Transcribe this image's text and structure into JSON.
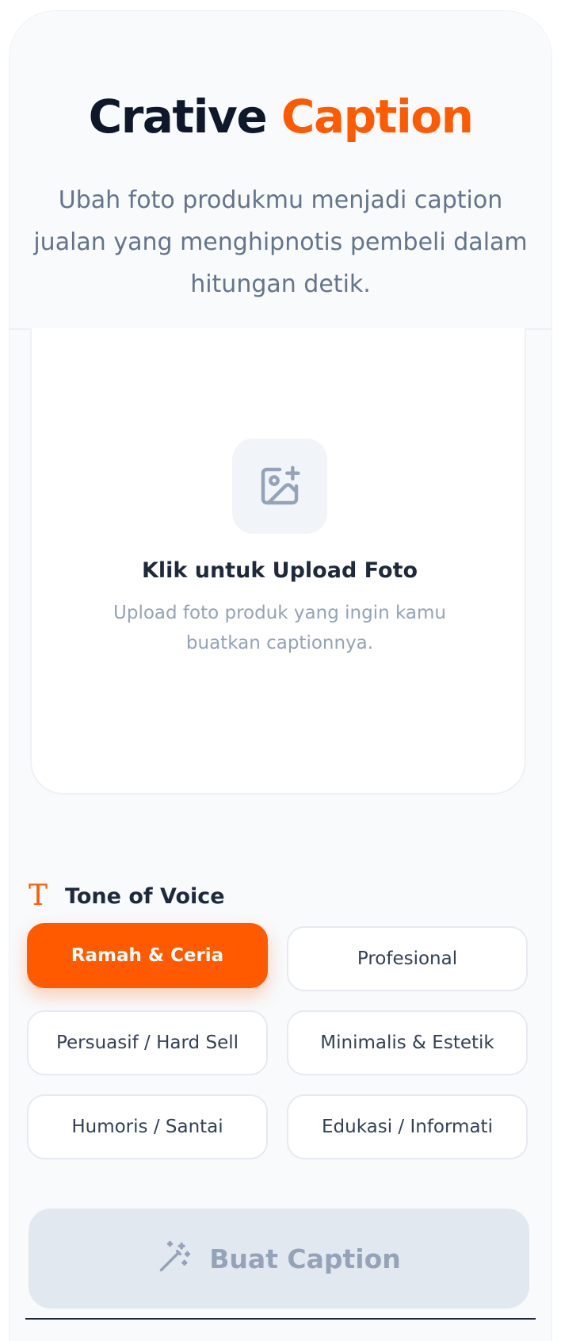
{
  "header": {
    "title_part1": "Crative",
    "title_part2": "Caption",
    "subtitle": "Ubah foto produkmu menjadi caption jualan yang menghipnotis pembeli dalam hitungan detik."
  },
  "upload": {
    "icon": "image-plus-icon",
    "title": "Klik untuk Upload Foto",
    "description": "Upload foto produk yang ingin kamu buatkan captionnya."
  },
  "tone": {
    "icon": "text-t-icon",
    "icon_glyph": "T",
    "label": "Tone of Voice",
    "options": [
      {
        "label": "Ramah & Ceria",
        "selected": true
      },
      {
        "label": "Profesional",
        "selected": false
      },
      {
        "label": "Persuasif / Hard Sell",
        "selected": false
      },
      {
        "label": "Minimalis & Estetik",
        "selected": false
      },
      {
        "label": "Humoris / Santai",
        "selected": false
      },
      {
        "label": "Edukasi / Informati",
        "selected": false
      }
    ]
  },
  "action": {
    "icon": "magic-wand-icon",
    "label": "Buat Caption"
  },
  "colors": {
    "accent": "#ff5a00",
    "title_dark": "#0f172a",
    "muted_text": "#64748b",
    "disabled_bg": "#e2e8f0"
  }
}
